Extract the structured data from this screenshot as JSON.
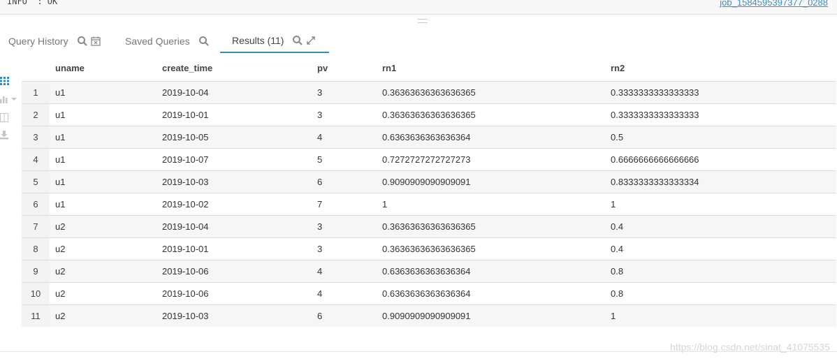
{
  "log": {
    "line": "INFO  : OK",
    "job_link": "job_1584595397377_0288"
  },
  "tabs": [
    {
      "label": "Query History",
      "icons": [
        "search-icon",
        "calendar-clear-icon"
      ]
    },
    {
      "label": "Saved Queries",
      "icons": [
        "search-icon"
      ]
    },
    {
      "label": "Results (11)",
      "icons": [
        "search-icon",
        "expand-icon"
      ],
      "active": true
    }
  ],
  "rail": [
    "grid-view-icon",
    "chart-icon",
    "columns-icon",
    "download-icon"
  ],
  "table": {
    "headers": [
      "uname",
      "create_time",
      "pv",
      "rn1",
      "rn2"
    ],
    "rows": [
      [
        "1",
        "u1",
        "2019-10-04",
        "3",
        "0.36363636363636365",
        "0.3333333333333333"
      ],
      [
        "2",
        "u1",
        "2019-10-01",
        "3",
        "0.36363636363636365",
        "0.3333333333333333"
      ],
      [
        "3",
        "u1",
        "2019-10-05",
        "4",
        "0.6363636363636364",
        "0.5"
      ],
      [
        "4",
        "u1",
        "2019-10-07",
        "5",
        "0.7272727272727273",
        "0.6666666666666666"
      ],
      [
        "5",
        "u1",
        "2019-10-03",
        "6",
        "0.9090909090909091",
        "0.8333333333333334"
      ],
      [
        "6",
        "u1",
        "2019-10-02",
        "7",
        "1",
        "1"
      ],
      [
        "7",
        "u2",
        "2019-10-04",
        "3",
        "0.36363636363636365",
        "0.4"
      ],
      [
        "8",
        "u2",
        "2019-10-01",
        "3",
        "0.36363636363636365",
        "0.4"
      ],
      [
        "9",
        "u2",
        "2019-10-06",
        "4",
        "0.6363636363636364",
        "0.8"
      ],
      [
        "10",
        "u2",
        "2019-10-06",
        "4",
        "0.6363636363636364",
        "0.8"
      ],
      [
        "11",
        "u2",
        "2019-10-03",
        "6",
        "0.9090909090909091",
        "1"
      ]
    ]
  },
  "watermark": "https://blog.csdn.net/sinat_41075535",
  "colors": {
    "accent": "#338bb8",
    "link": "#3b8fbf",
    "row_alt": "#f6f6f6"
  }
}
